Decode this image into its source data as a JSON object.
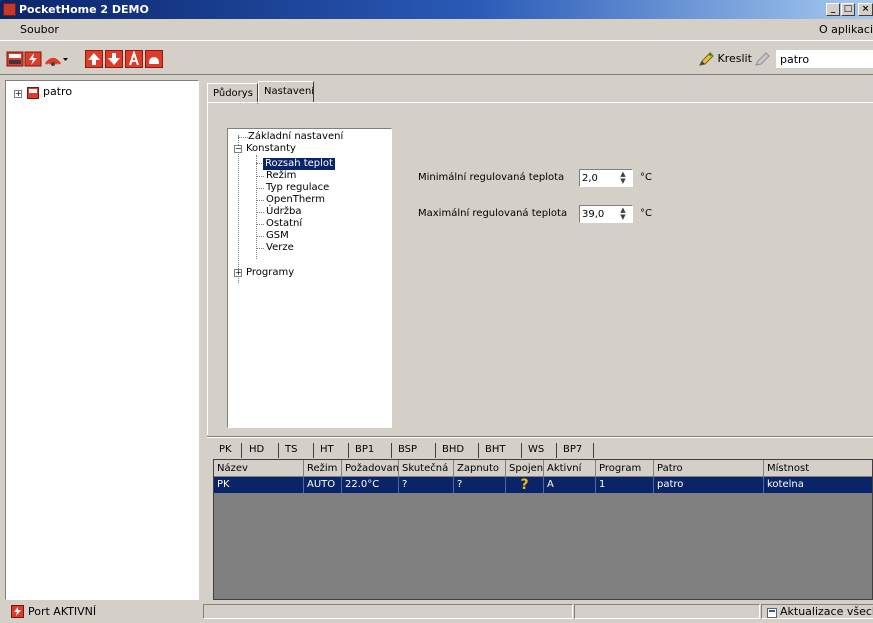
{
  "window": {
    "title": "PocketHome 2 DEMO",
    "min_glyph": "_",
    "max_glyph": "□",
    "close_glyph": "×"
  },
  "menu": {
    "file": "Soubor",
    "about": "O aplikaci"
  },
  "toolbar": {
    "draw_label": "Kreslit",
    "floor_value": "patro"
  },
  "left_tree": {
    "root_label": "patro",
    "expander_glyph": "+"
  },
  "main_tabs": [
    {
      "label": "Půdorys"
    },
    {
      "label": "Nastavení"
    }
  ],
  "settings_tree": {
    "basic": "Základní nastavení",
    "constants": "Konstanty",
    "constants_expander": "−",
    "children": [
      "Rozsah teplot",
      "Režim",
      "Typ regulace",
      "OpenTherm",
      "Údržba",
      "Ostatní",
      "GSM",
      "Verze"
    ],
    "selected": "Rozsah teplot",
    "programs": "Programy",
    "programs_expander": "+"
  },
  "fields": {
    "min_label": "Minimální regulovaná teplota",
    "min_value": "2,0",
    "max_label": "Maximální regulovaná teplota",
    "max_value": "39,0",
    "unit": "°C",
    "spin_up": "▲",
    "spin_down": "▼"
  },
  "bottom_tabs": [
    "PK",
    "HD",
    "TS",
    "HT",
    "BP1",
    "BSP",
    "BHD",
    "BHT",
    "WS",
    "BP7"
  ],
  "grid": {
    "columns": [
      "Název",
      "Režim",
      "Požadovaná",
      "Skutečná",
      "Zapnuto",
      "Spojení",
      "Aktivní",
      "Program",
      "Patro",
      "Místnost"
    ],
    "rows": [
      [
        "PK",
        "AUTO",
        "22.0°C",
        "?",
        "?",
        "?",
        "A",
        "1",
        "patro",
        "kotelna"
      ]
    ]
  },
  "status": {
    "port": "Port AKTIVNÍ",
    "update": "Aktualizace všech"
  },
  "colors": {
    "selection": "#0a246a",
    "accent_red": "#e03a2a",
    "face": "#d4d0c8",
    "warning": "#f0c000"
  }
}
